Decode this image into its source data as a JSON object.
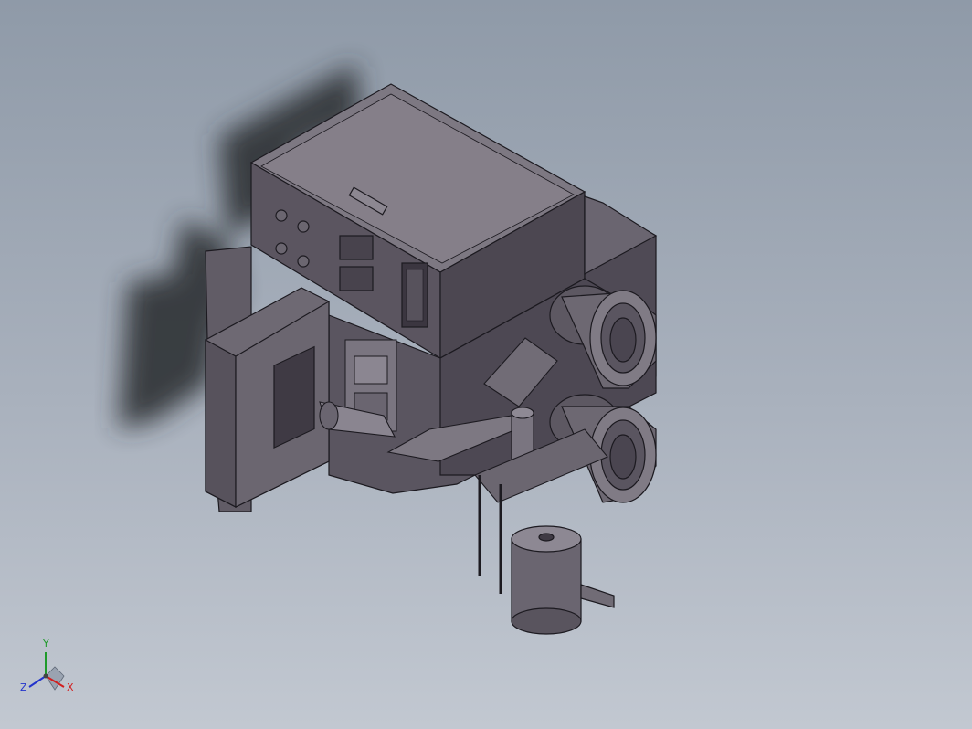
{
  "viewport": {
    "background_top": "#8f9aa8",
    "background_bottom": "#c2c8d1"
  },
  "model": {
    "part_color": "#5f5a63",
    "edge_color": "#1c1a20"
  },
  "triad": {
    "x_label": "X",
    "y_label": "Y",
    "z_label": "Z",
    "x_color": "#d21f1f",
    "y_color": "#1f9a2a",
    "z_color": "#2233cc"
  }
}
